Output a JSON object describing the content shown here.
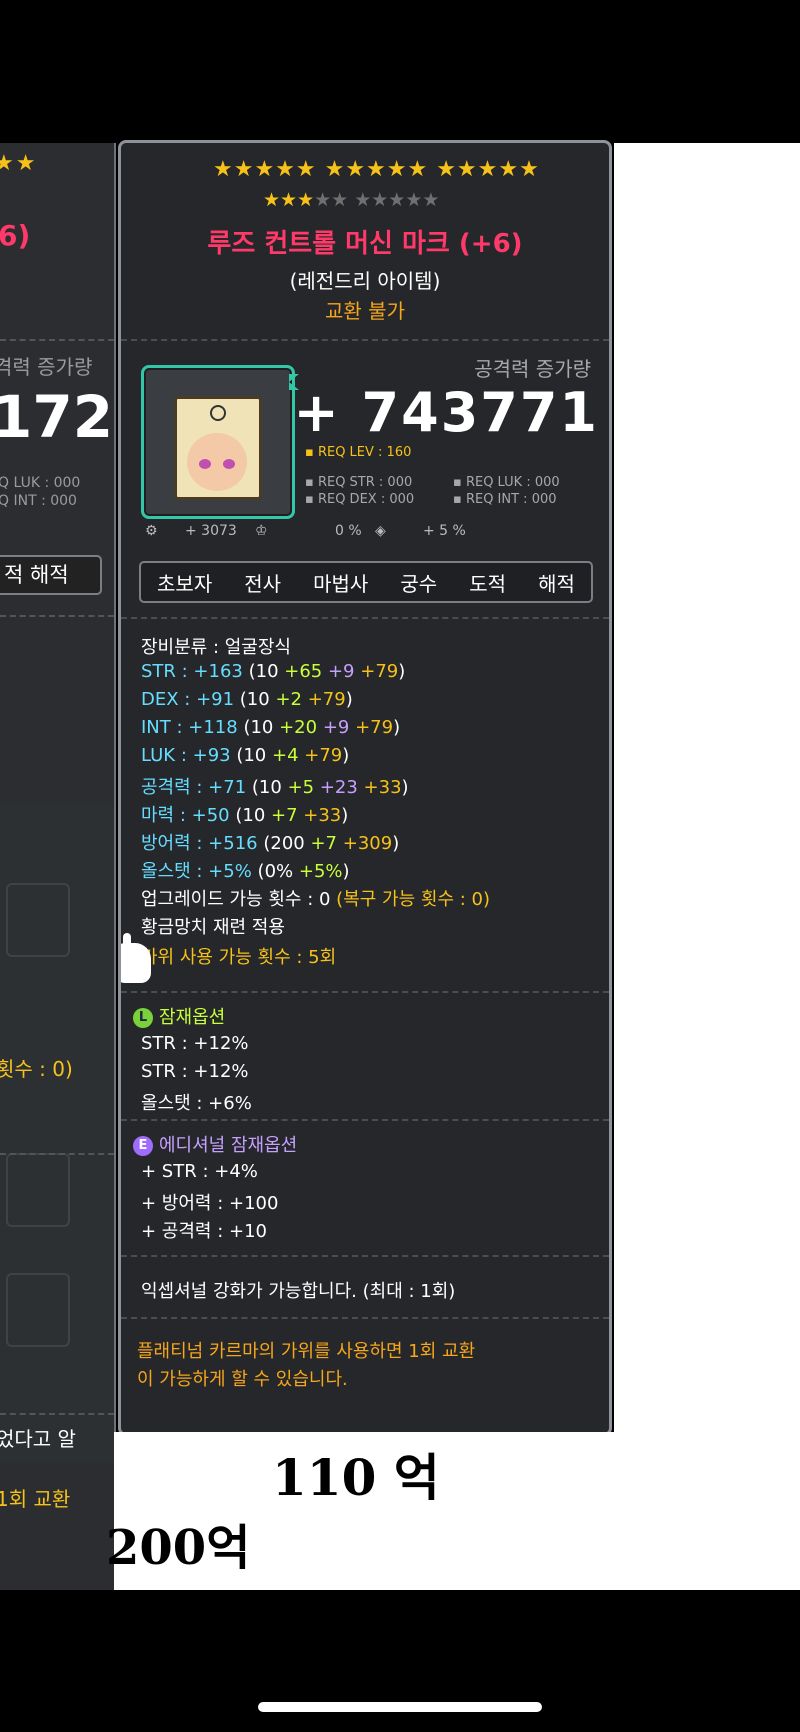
{
  "left_panel": {
    "stars": "★★",
    "name_fragment": "6)",
    "incr_fragment": "격력 증가량",
    "number_fragment": "172",
    "req_line1": "Q LUK : 000",
    "req_line2": "Q INT : 000",
    "jobs_fragment": "적  해적",
    "count_fragment": "횟수 : 0)",
    "said_fragment": "었다고 알",
    "trade_fragment": "1회 교환"
  },
  "tooltip": {
    "stars_row1": "★★★★★ ★★★★★ ★★★★★",
    "stars_row2_on": "★★★",
    "stars_row2_off": "★★ ★★★★★",
    "item_name": "루즈 컨트롤 머신 마크 (+6)",
    "grade": "(레전드리 아이템)",
    "trade": "교환 불가",
    "attack_increase_label": "공격력 증가량",
    "attack_increase_value": "+ 743771",
    "req_lev": "▪ REQ LEV : 160",
    "req_str": "▪ REQ STR : 000",
    "req_luk": "▪ REQ LUK : 000",
    "req_dex": "▪ REQ DEX : 000",
    "req_int": "▪ REQ INT : 000",
    "misc_1": "+ 3073",
    "misc_2": "0 %",
    "misc_3": "+ 5 %",
    "jobs": [
      "초보자",
      "전사",
      "마법사",
      "궁수",
      "도적",
      "해적"
    ],
    "category": "장비분류 : 얼굴장식",
    "stats": [
      {
        "label": "STR : +163",
        "base": " (10 ",
        "g": "+65",
        "p": " +9",
        "y": " +79",
        "end": ")"
      },
      {
        "label": "DEX : +91",
        "base": " (10 ",
        "g": "+2",
        "p": "",
        "y": " +79",
        "end": ")"
      },
      {
        "label": "INT : +118",
        "base": " (10 ",
        "g": "+20",
        "p": " +9",
        "y": " +79",
        "end": ")"
      },
      {
        "label": "LUK : +93",
        "base": " (10 ",
        "g": "+4",
        "p": "",
        "y": " +79",
        "end": ")"
      },
      {
        "label": "공격력 : +71",
        "base": " (10 ",
        "g": "+5",
        "p": " +23",
        "y": " +33",
        "end": ")"
      },
      {
        "label": "마력 : +50",
        "base": " (10 ",
        "g": "+7",
        "p": "",
        "y": " +33",
        "end": ")"
      },
      {
        "label": "방어력 : +516",
        "base": " (200 ",
        "g": "+7",
        "p": "",
        "y": " +309",
        "end": ")"
      },
      {
        "label": "올스탯 : +5%",
        "base": " (0% ",
        "g": "+5%",
        "p": "",
        "y": "",
        "end": ")"
      }
    ],
    "upgrade": "업그레이드 가능 횟수 : 0",
    "upgrade_restore": " (복구 가능 횟수 : 0)",
    "golden_hammer": "황금망치 재련 적용",
    "scissors": "가위 사용 가능 횟수 : 5회",
    "potential_badge": "L",
    "potential_title": "잠재옵션",
    "potential_lines": [
      "STR : +12%",
      "STR : +12%",
      "올스탯 : +6%"
    ],
    "additional_badge": "E",
    "additional_title": "에디셔널 잠재옵션",
    "additional_lines": [
      "+ STR : +4%",
      "+ 방어력 : +100",
      "+ 공격력 : +10"
    ],
    "exceptional": "익셉셔널 강화가 가능합니다. (최대 : 1회)",
    "platinum_line1": "플래티넘 카르마의 가위를 사용하면 1회 교환",
    "platinum_line2": "이 가능하게 할 수 있습니다."
  },
  "handwriting": {
    "price_110": "110 억",
    "price_200": "200억"
  }
}
